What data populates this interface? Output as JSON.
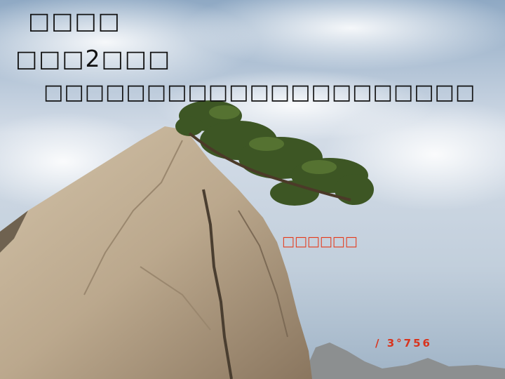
{
  "slide": {
    "line1": "□□□□",
    "line2": "□□□2□□□",
    "line3": "□□□□□□□□□□□□□□□□□□□□□",
    "caption": "□□□□□□",
    "stamp": "/ 3°756"
  },
  "colors": {
    "sky_top": "#9bb4cc",
    "sky_mid": "#d9e1ea",
    "sky_low": "#aec0d0",
    "rock_light": "#c7b59b",
    "rock_dark": "#8f7b63",
    "pine": "#3f5a24",
    "caption_red": "#e53a1c"
  },
  "icons": [
    "pine-tree-on-rock-photo"
  ]
}
